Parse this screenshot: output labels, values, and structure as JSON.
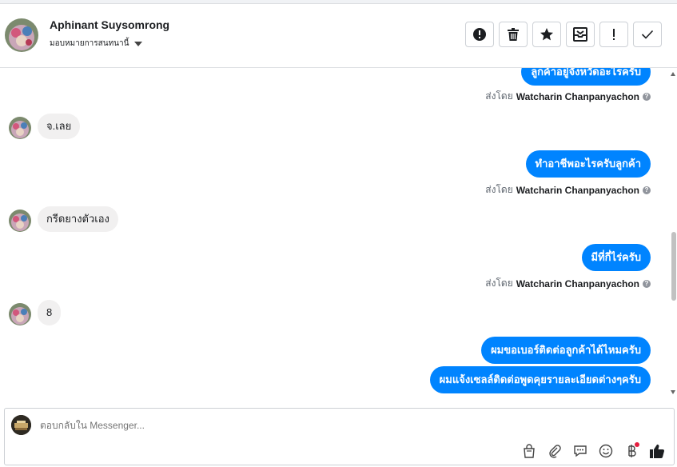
{
  "header": {
    "contact_name": "Aphinant Suysomrong",
    "assign_label": "มอบหมายการสนทนานี้",
    "actions": [
      {
        "name": "report-button",
        "icon": "exclamation-circle-icon"
      },
      {
        "name": "delete-button",
        "icon": "trash-icon"
      },
      {
        "name": "star-button",
        "icon": "star-icon"
      },
      {
        "name": "move-button",
        "icon": "inbox-icon"
      },
      {
        "name": "spam-button",
        "icon": "exclamation-icon"
      },
      {
        "name": "done-button",
        "icon": "check-icon"
      }
    ]
  },
  "messages": [
    {
      "dir": "out",
      "text": "ลูกค้าอยู่จังหวัดอะไรครับ",
      "sent_prefix": "ส่งโดย",
      "sender": "Watcharin Chanpanyachon"
    },
    {
      "dir": "in",
      "text": "จ.เลย"
    },
    {
      "dir": "out",
      "text": "ทำอาชีพอะไรครับลูกค้า",
      "sent_prefix": "ส่งโดย",
      "sender": "Watcharin Chanpanyachon"
    },
    {
      "dir": "in",
      "text": "กรีดยางตัวเอง"
    },
    {
      "dir": "out",
      "text": "มีที่กี่ไร่ครับ",
      "sent_prefix": "ส่งโดย",
      "sender": "Watcharin Chanpanyachon"
    },
    {
      "dir": "in",
      "text": "8"
    },
    {
      "dir": "out",
      "text": "ผมขอเบอร์ติดต่อลูกค้าได้ไหมครับ"
    },
    {
      "dir": "out",
      "text": "ผมแจ้งเซลล์ติดต่อพูดคุยรายละเอียดต่างๆครับ"
    }
  ],
  "composer": {
    "placeholder": "ตอบกลับใน Messenger...",
    "tools": [
      "shopping-bag-icon",
      "paperclip-icon",
      "saved-reply-icon",
      "emoji-icon",
      "baht-payment-icon",
      "thumbs-up-icon"
    ]
  },
  "colors": {
    "accent": "#0084ff",
    "incoming_bubble": "#f1f0f0",
    "notify_dot": "#e41e3f"
  }
}
